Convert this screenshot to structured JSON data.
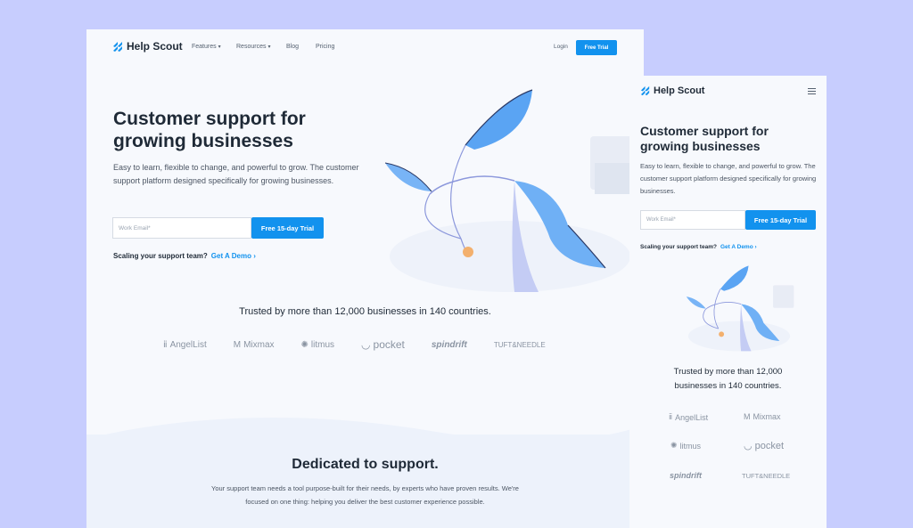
{
  "desktop": {
    "brand": "Help Scout",
    "nav": [
      {
        "label": "Features",
        "chevron": true
      },
      {
        "label": "Resources",
        "chevron": true
      },
      {
        "label": "Blog",
        "chevron": false
      },
      {
        "label": "Pricing",
        "chevron": false
      }
    ],
    "login": "Login",
    "nav_cta": "Free Trial",
    "hero_title": "Customer support for growing businesses",
    "hero_sub": "Easy to learn, flexible to change, and powerful to grow. The customer support platform designed specifically for growing businesses.",
    "email_placeholder": "Work Email*",
    "hero_cta": "Free 15-day Trial",
    "scaling": "Scaling your support team?",
    "demo": "Get A Demo ›",
    "trusted": "Trusted by more than 12,000 businesses in 140 countries.",
    "logos": [
      "AngelList",
      "Mixmax",
      "litmus",
      "pocket",
      "spindrift",
      "TUFT&NEEDLE"
    ],
    "dedicated_title": "Dedicated to support.",
    "dedicated_text": "Your support team needs a tool purpose-built for their needs, by experts who have proven results. We're focused on one thing: helping you deliver the best customer experience possible."
  },
  "mobile": {
    "brand": "Help Scout",
    "hero_title": "Customer support for growing businesses",
    "hero_sub": "Easy to learn, flexible to change, and powerful to grow. The customer support platform designed specifically for growing businesses.",
    "email_placeholder": "Work Email*",
    "hero_cta": "Free 15-day Trial",
    "scaling": "Scaling your support team?",
    "demo": "Get A Demo ›",
    "trusted": "Trusted by more than 12,000 businesses in 140 countries.",
    "logos": [
      "AngelList",
      "Mixmax",
      "litmus",
      "pocket",
      "spindrift",
      "TUFT&NEEDLE"
    ]
  },
  "colors": {
    "background": "#c7cdfe",
    "accent": "#1292ee",
    "brand_mark": "#1292ee"
  }
}
